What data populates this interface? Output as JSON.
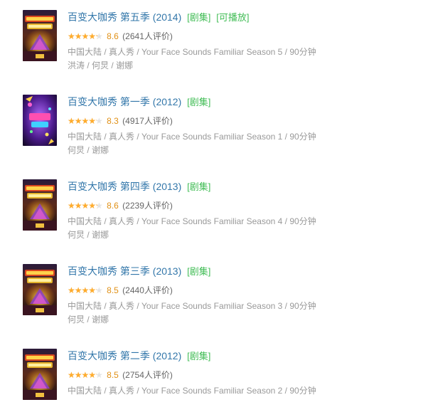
{
  "items": [
    {
      "title": "百变大咖秀 第五季 (2014)",
      "tags": [
        "[剧集]",
        "[可播放]"
      ],
      "rating_fraction": 0.86,
      "score": "8.6",
      "count": "(2641人评价)",
      "info": "中国大陆 / 真人秀 / Your Face Sounds Familiar Season 5 / 90分钟",
      "cast": "洪涛 / 何炅 / 谢娜",
      "poster_style": "gold"
    },
    {
      "title": "百变大咖秀 第一季 (2012)",
      "tags": [
        "[剧集]"
      ],
      "rating_fraction": 0.83,
      "score": "8.3",
      "count": "(4917人评价)",
      "info": "中国大陆 / 真人秀 / Your Face Sounds Familiar Season 1 / 90分钟",
      "cast": "何炅 / 谢娜",
      "poster_style": "purple"
    },
    {
      "title": "百变大咖秀 第四季 (2013)",
      "tags": [
        "[剧集]"
      ],
      "rating_fraction": 0.86,
      "score": "8.6",
      "count": "(2239人评价)",
      "info": "中国大陆 / 真人秀 / Your Face Sounds Familiar Season 4 / 90分钟",
      "cast": "何炅 / 谢娜",
      "poster_style": "gold"
    },
    {
      "title": "百变大咖秀 第三季 (2013)",
      "tags": [
        "[剧集]"
      ],
      "rating_fraction": 0.85,
      "score": "8.5",
      "count": "(2440人评价)",
      "info": "中国大陆 / 真人秀 / Your Face Sounds Familiar Season 3 / 90分钟",
      "cast": "何炅 / 谢娜",
      "poster_style": "gold"
    },
    {
      "title": "百变大咖秀 第二季 (2012)",
      "tags": [
        "[剧集]"
      ],
      "rating_fraction": 0.85,
      "score": "8.5",
      "count": "(2754人评价)",
      "info": "中国大陆 / 真人秀 / Your Face Sounds Familiar Season 2 / 90分钟",
      "cast": "",
      "poster_style": "gold"
    }
  ],
  "colors": {
    "title": "#3377aa",
    "tag": "#42bd56",
    "star": "#ffac2d",
    "score": "#e09015",
    "meta": "#999999"
  }
}
